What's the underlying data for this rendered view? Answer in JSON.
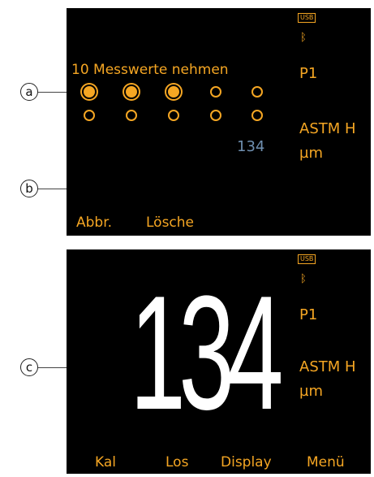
{
  "screen1": {
    "usb_label": "USB",
    "bluetooth_icon": "bluetooth-icon",
    "title": "10 Messwerte nehmen",
    "probe": "P1",
    "standard": "ASTM H",
    "unit": "µm",
    "current_value": "134",
    "measurement_slots_filled": 3,
    "measurement_slots_total": 10,
    "softkeys": [
      "Abbr.",
      "Lösche"
    ]
  },
  "screen2": {
    "usb_label": "USB",
    "bluetooth_icon": "bluetooth-icon",
    "reading": "134",
    "probe": "P1",
    "standard": "ASTM H",
    "unit": "µm",
    "softkeys": [
      "Kal",
      "Los",
      "Display",
      "Menü"
    ]
  },
  "callouts": [
    "a",
    "b",
    "c"
  ],
  "colors": {
    "accent": "#f5a623",
    "background": "#000000",
    "reading": "#ffffff",
    "value_small": "#6f8fb0"
  }
}
